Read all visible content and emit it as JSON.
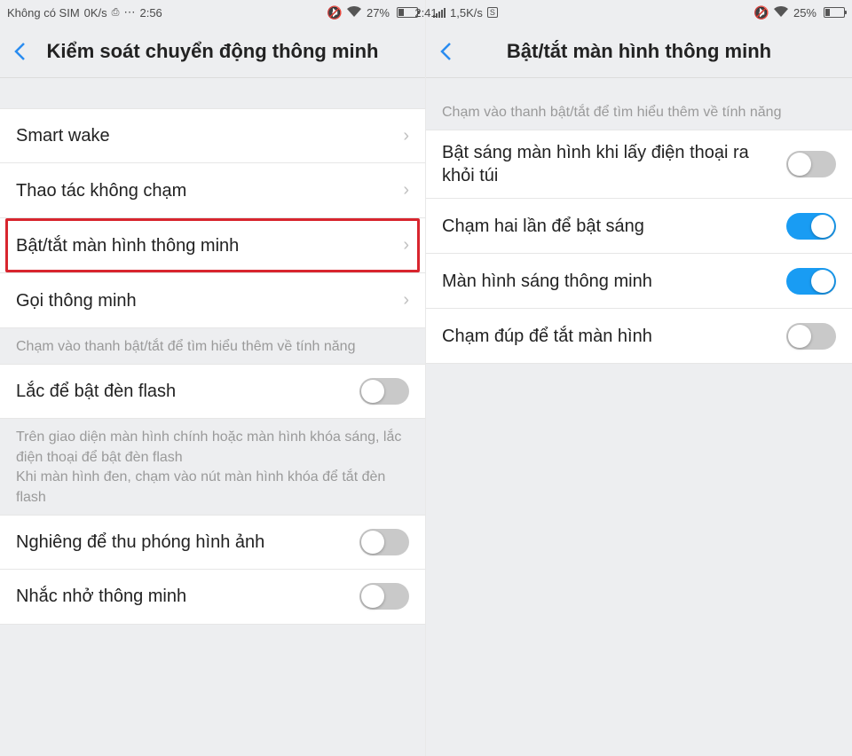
{
  "left": {
    "status": {
      "carrier": "Không có SIM",
      "speed": "0K/s",
      "time": "2:56",
      "battery_pct": "27%",
      "battery_fill": 27
    },
    "title": "Kiểm soát chuyển động thông minh",
    "items": {
      "smart_wake": "Smart wake",
      "no_touch": "Thao tác không chạm",
      "smart_screen": "Bật/tắt màn hình thông minh",
      "smart_call": "Gọi thông minh"
    },
    "hint1": "Chạm vào thanh bật/tắt để tìm hiểu thêm về tính năng",
    "flash": "Lắc để bật đèn flash",
    "hint2": "Trên giao diện màn hình chính hoặc màn hình khóa sáng, lắc điện thoại để bật đèn flash\nKhi màn hình đen, chạm vào nút màn hình khóa để tắt đèn flash",
    "tilt": "Nghiêng để thu phóng hình ảnh",
    "remind": "Nhắc nhở thông minh"
  },
  "right": {
    "status": {
      "carrier": "",
      "speed": "1,5K/s",
      "time": "2:41",
      "battery_pct": "25%",
      "battery_fill": 25
    },
    "title": "Bật/tắt màn hình thông minh",
    "hint": "Chạm vào thanh bật/tắt để tìm hiểu thêm về tính năng",
    "items": {
      "pocket": "Bật sáng màn hình khi lấy điện thoại ra khỏi túi",
      "double_tap_on": "Chạm hai lần để bật sáng",
      "smart_bright": "Màn hình sáng thông minh",
      "double_tap_off": "Chạm đúp để tắt màn hình"
    },
    "toggles": {
      "pocket": false,
      "double_tap_on": true,
      "smart_bright": true,
      "double_tap_off": false
    }
  }
}
